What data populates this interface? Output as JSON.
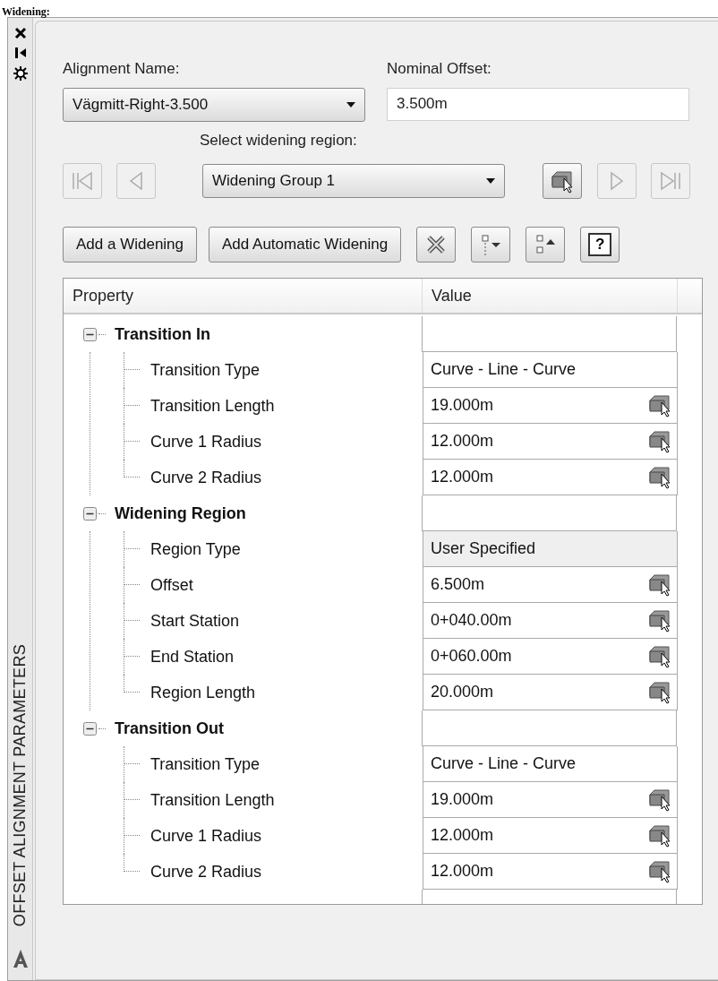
{
  "page_heading": "Widening:",
  "palette": {
    "title": "OFFSET ALIGNMENT PARAMETERS"
  },
  "alignment_name": {
    "label": "Alignment Name:",
    "value": "Vägmitt-Right-3.500"
  },
  "nominal_offset": {
    "label": "Nominal Offset:",
    "value": "3.500m"
  },
  "widening_region": {
    "label": "Select widening region:",
    "value": "Widening Group 1"
  },
  "nav_buttons": [
    {
      "kind": "first",
      "disabled": true
    },
    {
      "kind": "previous",
      "disabled": true
    },
    {
      "kind": "pick",
      "disabled": false
    },
    {
      "kind": "next",
      "disabled": true
    },
    {
      "kind": "last",
      "disabled": true
    }
  ],
  "buttons": [
    {
      "label": "Add a Widening"
    },
    {
      "label": "Add Automatic Widening"
    }
  ],
  "tool_buttons": [
    {
      "kind": "delete"
    },
    {
      "kind": "expand"
    },
    {
      "kind": "collapse"
    },
    {
      "kind": "help",
      "label": "?"
    }
  ],
  "table": {
    "columns": [
      "Property",
      "Value"
    ],
    "groups": [
      {
        "label": "Transition In",
        "expanded": true,
        "children": [
          {
            "name": "Transition Type",
            "value": "Curve - Line - Curve",
            "pickable": false,
            "read_only": false
          },
          {
            "name": "Transition Length",
            "value": "19.000m",
            "pickable": true,
            "read_only": false
          },
          {
            "name": "Curve 1 Radius",
            "value": "12.000m",
            "pickable": true,
            "read_only": false
          },
          {
            "name": "Curve 2 Radius",
            "value": "12.000m",
            "pickable": true,
            "read_only": false
          }
        ]
      },
      {
        "label": "Widening Region",
        "expanded": true,
        "children": [
          {
            "name": "Region Type",
            "value": "User Specified",
            "pickable": false,
            "read_only": true
          },
          {
            "name": "Offset",
            "value": "6.500m",
            "pickable": true,
            "read_only": false
          },
          {
            "name": "Start Station",
            "value": "0+040.00m",
            "pickable": true,
            "read_only": false
          },
          {
            "name": "End Station",
            "value": "0+060.00m",
            "pickable": true,
            "read_only": false
          },
          {
            "name": "Region Length",
            "value": "20.000m",
            "pickable": true,
            "read_only": false
          }
        ]
      },
      {
        "label": "Transition Out",
        "expanded": true,
        "children": [
          {
            "name": "Transition Type",
            "value": "Curve - Line - Curve",
            "pickable": false,
            "read_only": false
          },
          {
            "name": "Transition Length",
            "value": "19.000m",
            "pickable": true,
            "read_only": false
          },
          {
            "name": "Curve 1 Radius",
            "value": "12.000m",
            "pickable": true,
            "read_only": false
          },
          {
            "name": "Curve 2 Radius",
            "value": "12.000m",
            "pickable": true,
            "read_only": false
          }
        ]
      }
    ]
  }
}
